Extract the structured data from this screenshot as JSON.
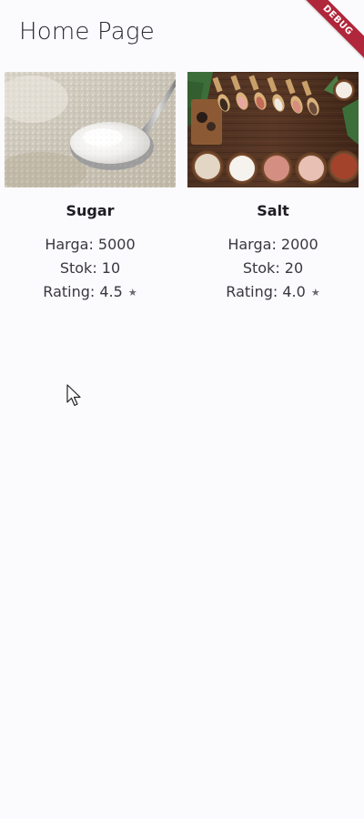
{
  "appbar": {
    "title": "Home Page",
    "debug_label": "DEBUG"
  },
  "products": [
    {
      "name": "Sugar",
      "price_label": "Harga: 5000",
      "stock_label": "Stok: 10",
      "rating_label": "Rating: 4.5",
      "image": "sugar-spoon-photo"
    },
    {
      "name": "Salt",
      "price_label": "Harga: 2000",
      "stock_label": "Stok: 20",
      "rating_label": "Rating: 4.0",
      "image": "salt-bowls-photo"
    }
  ],
  "icons": {
    "rating": "star-icon"
  },
  "colors": {
    "background": "#fbfafd",
    "debug_ribbon": "#b0263a",
    "text_primary": "#1f1d24"
  }
}
